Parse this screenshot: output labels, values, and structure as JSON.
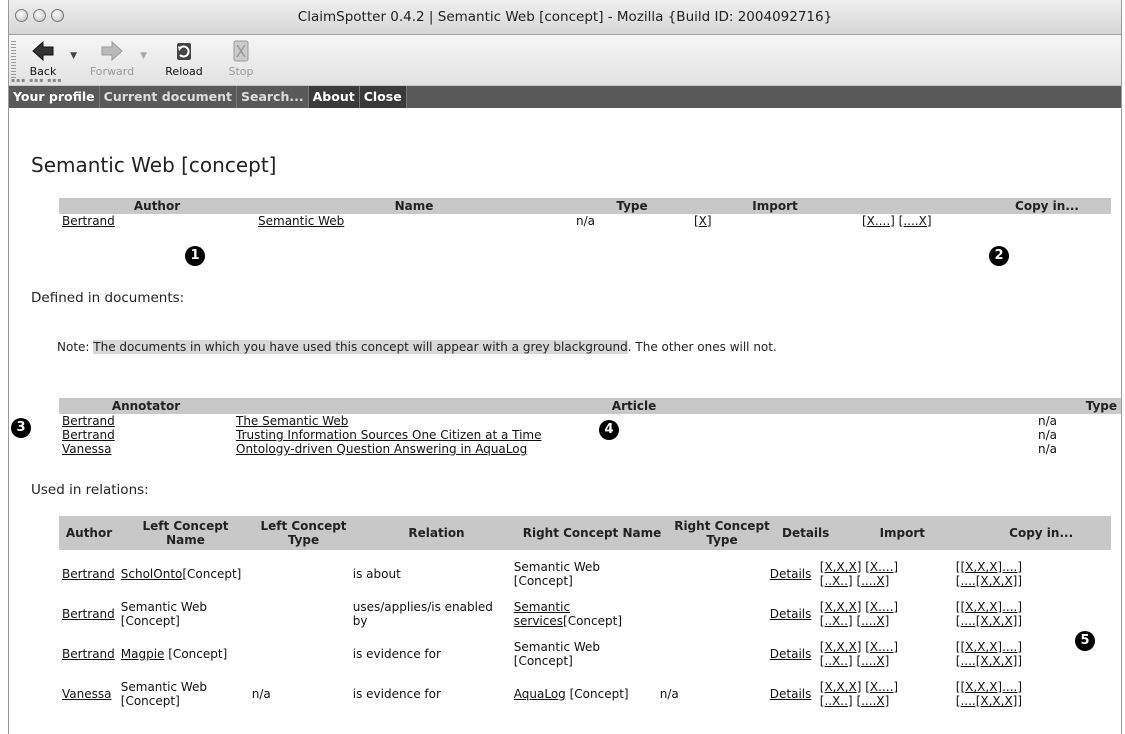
{
  "window": {
    "title": "ClaimSpotter 0.4.2 | Semantic Web [concept] - Mozilla {Build ID: 2004092716}"
  },
  "toolbar": {
    "back": "Back",
    "forward": "Forward",
    "reload": "Reload",
    "stop": "Stop"
  },
  "nav": {
    "items": [
      "Your profile",
      "Current document",
      "Search...",
      "About",
      "Close"
    ]
  },
  "page": {
    "title": "Semantic Web [concept]",
    "concept_table": {
      "headers": [
        "Author",
        "Name",
        "Type",
        "Import",
        "Copy in..."
      ],
      "row": {
        "author": "Bertrand",
        "name": "Semantic Web",
        "type": "n/a",
        "import": "[X]",
        "copy_a": "[X....]",
        "copy_b": "[....X]"
      }
    },
    "defined_label": "Defined in documents:",
    "note": {
      "prefix": "Note: ",
      "highlight": "The documents in which you have used this concept will appear with a grey blackground",
      "suffix": ". The other ones will not."
    },
    "docs_table": {
      "headers": [
        "Annotator",
        "Article",
        "Type"
      ],
      "rows": [
        {
          "annotator": "Bertrand",
          "article": "The Semantic Web",
          "type": "n/a"
        },
        {
          "annotator": "Bertrand",
          "article": "Trusting Information Sources One Citizen at a Time",
          "type": "n/a"
        },
        {
          "annotator": "Vanessa",
          "article": "Ontology-driven Question Answering in AquaLog",
          "type": "n/a"
        }
      ]
    },
    "relations_label": "Used in relations:",
    "rel_table": {
      "headers": [
        "Author",
        "Left Concept Name",
        "Left Concept Type",
        "Relation",
        "Right Concept Name",
        "Right Concept Type",
        "Details",
        "Import",
        "Copy in..."
      ],
      "rows": [
        {
          "author": "Bertrand",
          "left_link": "ScholOnto",
          "left_rest": "[Concept]",
          "left_type": "",
          "relation": "is about",
          "right_link": "",
          "right_rest": "Semantic Web [Concept]",
          "right_type": "",
          "details": "Details",
          "imp1": "[X,X,X]",
          "imp2": "[X....]",
          "imp3": "[..X..]",
          "imp4": "[....X]",
          "cp1": "[[X,X,X]....]",
          "cp2": "[....[X,X,X]]"
        },
        {
          "author": "Bertrand",
          "left_link": "",
          "left_rest": "Semantic Web [Concept]",
          "left_type": "",
          "relation": "uses/applies/is enabled by",
          "right_link": "Semantic services",
          "right_rest": "[Concept]",
          "right_type": "",
          "details": "Details",
          "imp1": "[X,X,X]",
          "imp2": "[X....]",
          "imp3": "[..X..]",
          "imp4": "[....X]",
          "cp1": "[[X,X,X]....]",
          "cp2": "[....[X,X,X]]"
        },
        {
          "author": "Bertrand",
          "left_link": "Magpie",
          "left_rest": " [Concept]",
          "left_type": "",
          "relation": "is evidence for",
          "right_link": "",
          "right_rest": "Semantic Web [Concept]",
          "right_type": "",
          "details": "Details",
          "imp1": "[X,X,X]",
          "imp2": "[X....]",
          "imp3": "[..X..]",
          "imp4": "[....X]",
          "cp1": "[[X,X,X]....]",
          "cp2": "[....[X,X,X]]"
        },
        {
          "author": "Vanessa",
          "left_link": "",
          "left_rest": "Semantic Web [Concept]",
          "left_type": "n/a",
          "relation": "is evidence for",
          "right_link": "AquaLog",
          "right_rest": " [Concept]",
          "right_type": "n/a",
          "details": "Details",
          "imp1": "[X,X,X]",
          "imp2": "[X....]",
          "imp3": "[..X..]",
          "imp4": "[....X]",
          "cp1": "[[X,X,X]....]",
          "cp2": "[....[X,X,X]]"
        }
      ]
    },
    "callouts": [
      "1",
      "2",
      "3",
      "4",
      "5"
    ]
  }
}
